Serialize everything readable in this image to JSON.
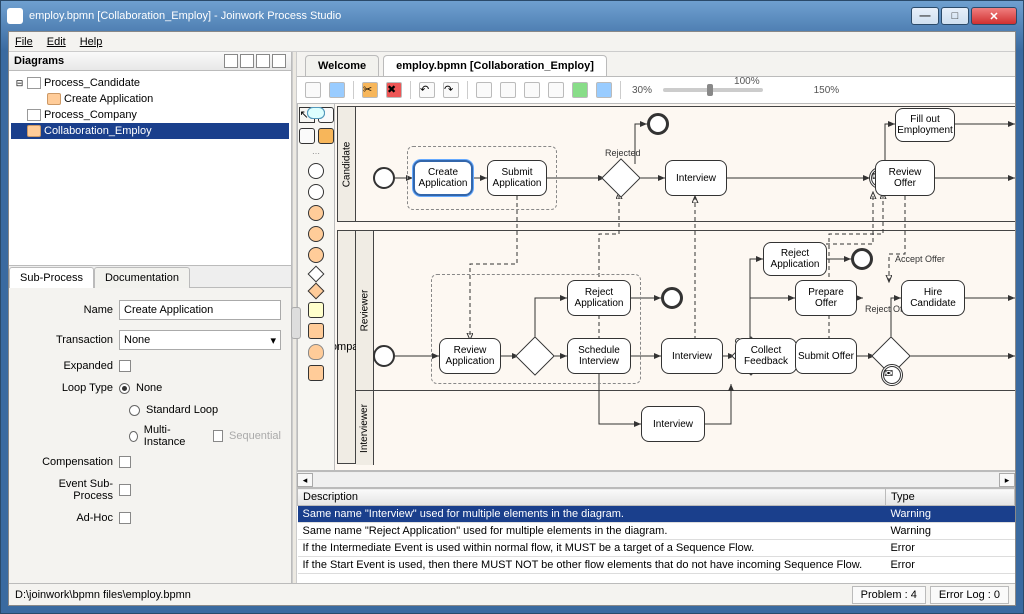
{
  "window": {
    "title": "employ.bpmn [Collaboration_Employ] - Joinwork Process Studio"
  },
  "menu": {
    "file": "File",
    "edit": "Edit",
    "help": "Help"
  },
  "diagrams": {
    "title": "Diagrams",
    "tree": {
      "root": "Process_Candidate",
      "root_child": "Create Application",
      "n2": "Process_Company",
      "n3": "Collaboration_Employ"
    }
  },
  "sub_tabs": {
    "subprocess": "Sub-Process",
    "documentation": "Documentation"
  },
  "props": {
    "name_label": "Name",
    "name_value": "Create Application",
    "transaction_label": "Transaction",
    "transaction_value": "None",
    "expanded_label": "Expanded",
    "looptype_label": "Loop Type",
    "loop_none": "None",
    "loop_std": "Standard Loop",
    "loop_multi": "Multi-Instance",
    "loop_seq": "Sequential",
    "compensation_label": "Compensation",
    "eventsub_label": "Event Sub-Process",
    "adhoc_label": "Ad-Hoc"
  },
  "editor_tabs": {
    "welcome": "Welcome",
    "file": "employ.bpmn [Collaboration_Employ]"
  },
  "zoom": {
    "min": "30%",
    "mid": "100%",
    "max": "150%"
  },
  "lanes": {
    "candidate": "Candidate",
    "company": "Company",
    "reviewer": "Reviewer",
    "interviewer": "Interviewer"
  },
  "tasks": {
    "create_app": "Create Application",
    "submit_app": "Submit Application",
    "interview_c": "Interview",
    "fill_emp": "Fill out Employment",
    "review_offer": "Review Offer",
    "reject_app_top": "Reject Application",
    "prepare_offer": "Prepare Offer",
    "hire_cand": "Hire Candidate",
    "reject_app2": "Reject Application",
    "review_app": "Review Application",
    "sched_int": "Schedule Interview",
    "interview_r": "Interview",
    "collect_fb": "Collect Feedback",
    "submit_offer": "Submit Offer",
    "interview_i": "Interview"
  },
  "edge_labels": {
    "rejected": "Rejected",
    "accept_offer": "Accept Offer",
    "reject_offer": "Reject Offer"
  },
  "problems": {
    "headers": {
      "desc": "Description",
      "type": "Type"
    },
    "rows": [
      {
        "desc": "Same name \"Interview\" used for multiple elements in the diagram.",
        "type": "Warning"
      },
      {
        "desc": "Same name \"Reject Application\" used for multiple elements in the diagram.",
        "type": "Warning"
      },
      {
        "desc": "If the Intermediate Event is used within normal flow, it MUST be a target of a Sequence Flow.",
        "type": "Error"
      },
      {
        "desc": "If the Start Event is used, then there MUST NOT be other flow elements that do not have incoming Sequence Flow.",
        "type": "Error"
      }
    ]
  },
  "status": {
    "path": "D:\\joinwork\\bpmn files\\employ.bpmn",
    "problem": "Problem : 4",
    "errlog": "Error Log : 0"
  }
}
